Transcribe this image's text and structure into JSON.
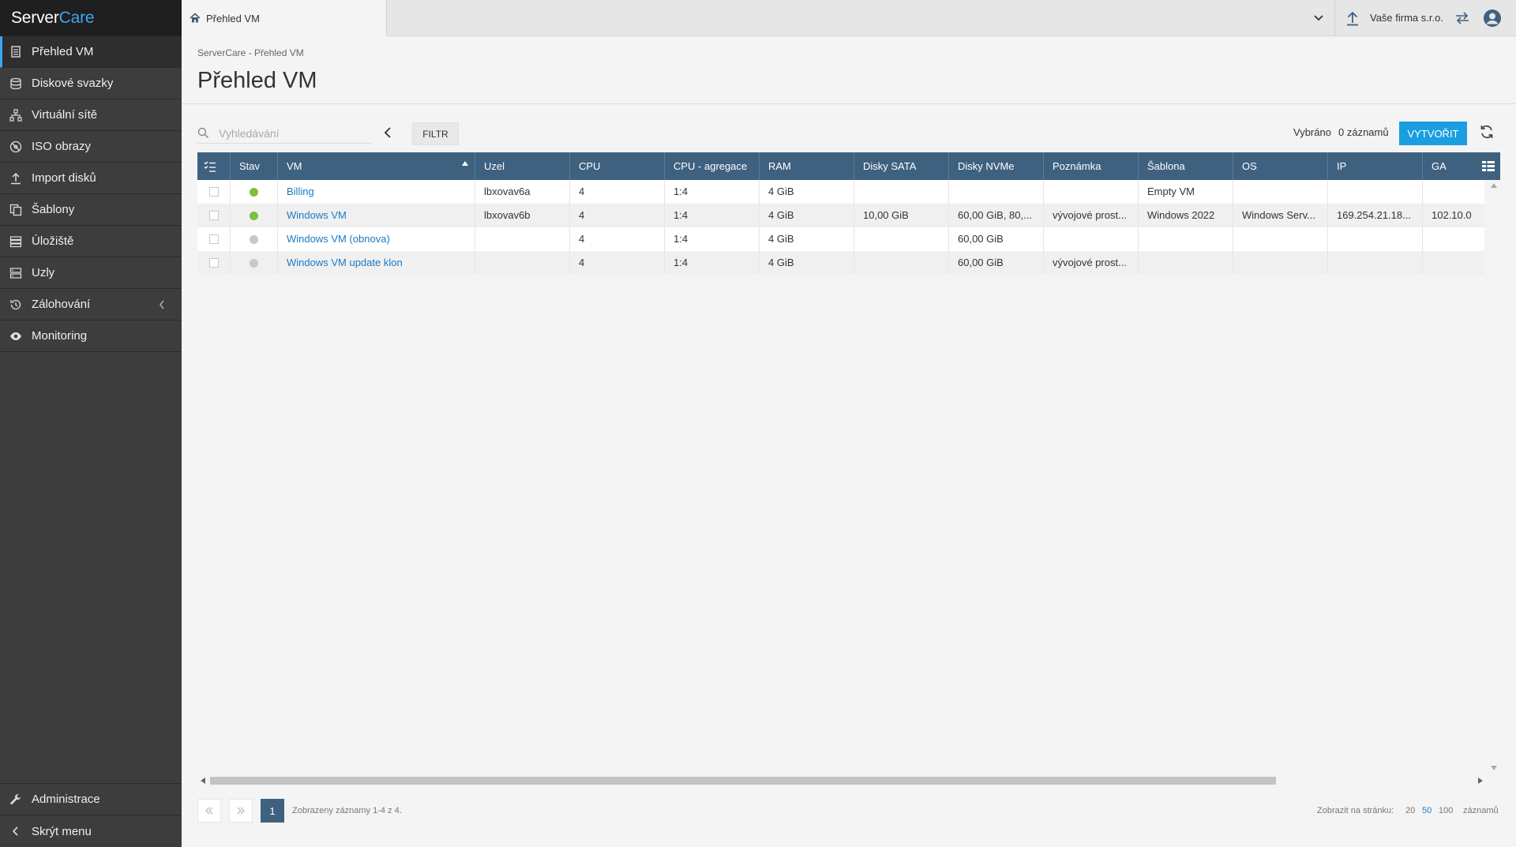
{
  "app": {
    "logo_server": "Server",
    "logo_care": "Care"
  },
  "sidebar": {
    "items": [
      {
        "label": "Přehled VM",
        "icon": "vm-list-icon",
        "active": true
      },
      {
        "label": "Diskové svazky",
        "icon": "database-icon"
      },
      {
        "label": "Virtuální sítě",
        "icon": "network-icon"
      },
      {
        "label": "ISO obrazy",
        "icon": "disc-icon"
      },
      {
        "label": "Import disků",
        "icon": "upload-icon"
      },
      {
        "label": "Šablony",
        "icon": "templates-icon"
      },
      {
        "label": "Úložiště",
        "icon": "storage-icon"
      },
      {
        "label": "Uzly",
        "icon": "nodes-icon"
      },
      {
        "label": "Zálohování",
        "icon": "backup-icon"
      },
      {
        "label": "Monitoring",
        "icon": "eye-icon"
      }
    ],
    "bottom": [
      {
        "label": "Administrace",
        "icon": "wrench-icon"
      },
      {
        "label": "Skrýt menu",
        "icon": "chevron-left-icon"
      }
    ]
  },
  "topbar": {
    "tab_label": "Přehled VM",
    "company": "Vaše firma s.r.o."
  },
  "main": {
    "breadcrumb": "ServerCare - Přehled VM",
    "title": "Přehled VM",
    "search_placeholder": "Vyhledávání",
    "filter_label": "FILTR",
    "selected_label": "Vybráno",
    "selected_count": "0 záznamů",
    "create_label": "VYTVOŘIT"
  },
  "table": {
    "columns": [
      "Stav",
      "VM",
      "Uzel",
      "CPU",
      "CPU - agregace",
      "RAM",
      "Disky SATA",
      "Disky NVMe",
      "Poznámka",
      "Šablona",
      "OS",
      "IP",
      "GA"
    ],
    "rows": [
      {
        "status": "running",
        "vm": "Billing",
        "uzel": "lbxovav6a",
        "cpu": "4",
        "agg": "1:4",
        "ram": "4 GiB",
        "sata": "",
        "nvme": "",
        "note": "",
        "template": "Empty VM",
        "os": "",
        "ip": "",
        "ga": ""
      },
      {
        "status": "running",
        "vm": "Windows VM",
        "uzel": "lbxovav6b",
        "cpu": "4",
        "agg": "1:4",
        "ram": "4 GiB",
        "sata": "10,00 GiB",
        "nvme": "60,00 GiB, 80,...",
        "note": "vývojové prost...",
        "template": "Windows 2022",
        "os": "Windows Serv...",
        "ip": "169.254.21.18...",
        "ga": "102.10.0"
      },
      {
        "status": "stopped",
        "vm": "Windows VM (obnova)",
        "uzel": "",
        "cpu": "4",
        "agg": "1:4",
        "ram": "4 GiB",
        "sata": "",
        "nvme": "60,00 GiB",
        "note": "",
        "template": "",
        "os": "",
        "ip": "",
        "ga": ""
      },
      {
        "status": "stopped",
        "vm": "Windows VM update klon",
        "uzel": "",
        "cpu": "4",
        "agg": "1:4",
        "ram": "4 GiB",
        "sata": "",
        "nvme": "60,00 GiB",
        "note": "vývojové prost...",
        "template": "",
        "os": "",
        "ip": "",
        "ga": ""
      }
    ]
  },
  "pager": {
    "current_page": "1",
    "info": "Zobrazeny záznamy 1-4 z 4.",
    "per_page_label": "Zobrazit na stránku:",
    "sizes": [
      "20",
      "50",
      "100"
    ],
    "active_size": "50",
    "suffix": "záznamů"
  },
  "colors": {
    "accent": "#1a9ee0",
    "header": "#3e6180",
    "running": "#7ac143",
    "stopped": "#c8c8c8",
    "link": "#1a7bc4"
  }
}
